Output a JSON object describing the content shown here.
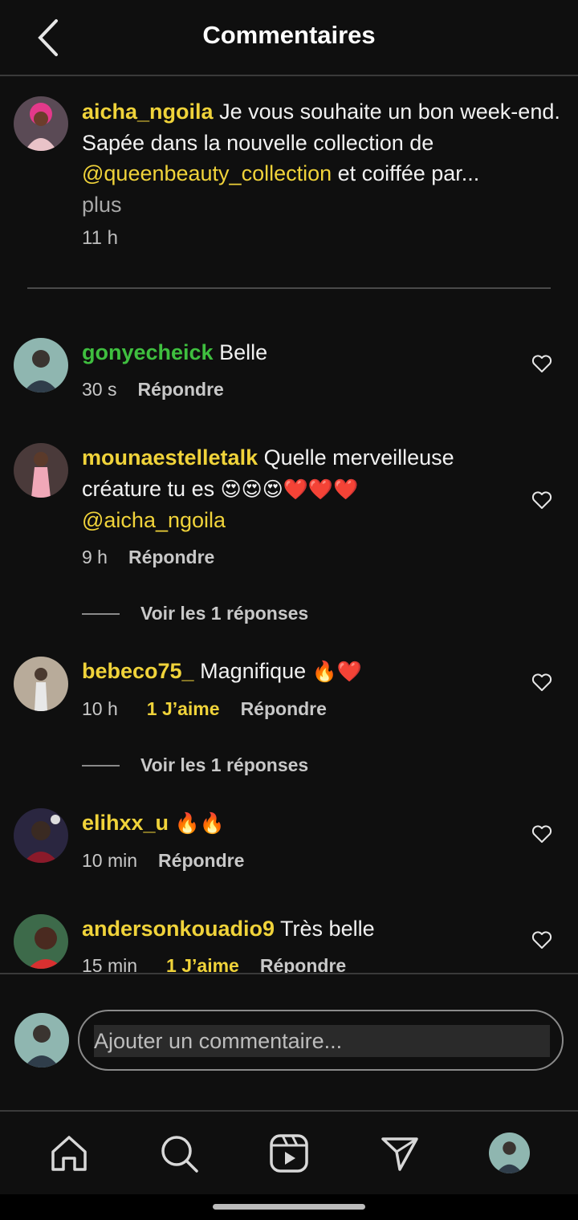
{
  "header": {
    "title": "Commentaires"
  },
  "caption": {
    "username": "aicha_ngoila",
    "text_1": " Je vous souhaite un bon week-end. Sapée dans la nouvelle collection de ",
    "mention": "@queenbeauty_collection",
    "text_2": " et coiffée par...",
    "more": "plus",
    "time": "11 h"
  },
  "comments": [
    {
      "username": "gonyecheick",
      "text": " Belle",
      "time": "30 s",
      "reply": "Répondre"
    },
    {
      "username": "mounaestelletalk",
      "text": " Quelle merveilleuse créature tu es ",
      "emojis": "😍😍😍❤️❤️❤️",
      "mention": "@aicha_ngoila",
      "time": "9 h",
      "reply": "Répondre",
      "view_replies": "Voir les 1 réponses"
    },
    {
      "username": "bebeco75_",
      "text": " Magnifique ",
      "emojis": "🔥❤️",
      "time": "10 h",
      "likes": "1 J’aime",
      "reply": "Répondre",
      "view_replies": "Voir les 1 réponses"
    },
    {
      "username": "elihxx_u",
      "text": " ",
      "emojis": "🔥🔥",
      "time": "10 min",
      "reply": "Répondre"
    },
    {
      "username": "andersonkouadio9",
      "text": " Très belle",
      "time": "15 min",
      "likes": "1 J’aime",
      "reply": "Répondre"
    }
  ],
  "input": {
    "placeholder": "Ajouter un commentaire..."
  },
  "nav": {
    "icons": [
      "home-icon",
      "search-icon",
      "reels-icon",
      "send-icon",
      "profile-avatar"
    ]
  },
  "colors": {
    "accent": "#f0d33a",
    "green_username": "#3fbf3f",
    "background": "#0f0f0f"
  }
}
